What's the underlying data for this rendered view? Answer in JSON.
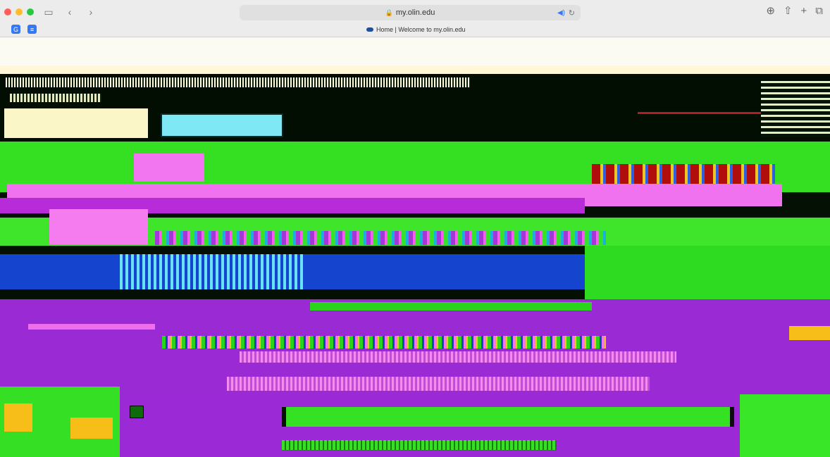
{
  "browser": {
    "url": "my.olin.edu",
    "tab_title": "Home | Welcome to my.olin.edu",
    "icons": {
      "back": "chevron-left-icon",
      "forward": "chevron-right-icon",
      "sidebar": "sidebar-icon",
      "lock": "lock-icon",
      "audio": "speaker-icon",
      "reload": "reload-icon",
      "download": "download-icon",
      "share": "share-icon",
      "new_tab": "plus-icon",
      "tab_overview": "tabs-icon"
    },
    "glyphs": {
      "back": "‹",
      "forward": "›",
      "sidebar": "▭",
      "lock": "🔒",
      "audio": "◀)",
      "reload": "↻",
      "download": "⊕",
      "share": "⇧",
      "new_tab": "+",
      "tab_overview": "⧉",
      "left_btn_a": "G",
      "left_btn_b": "≡"
    }
  },
  "colors": {
    "chrome_bg": "#ececec",
    "content_green": "#34e021",
    "content_pink": "#f072ef",
    "content_purple": "#9a2ad4",
    "content_blue": "#1545cf"
  }
}
